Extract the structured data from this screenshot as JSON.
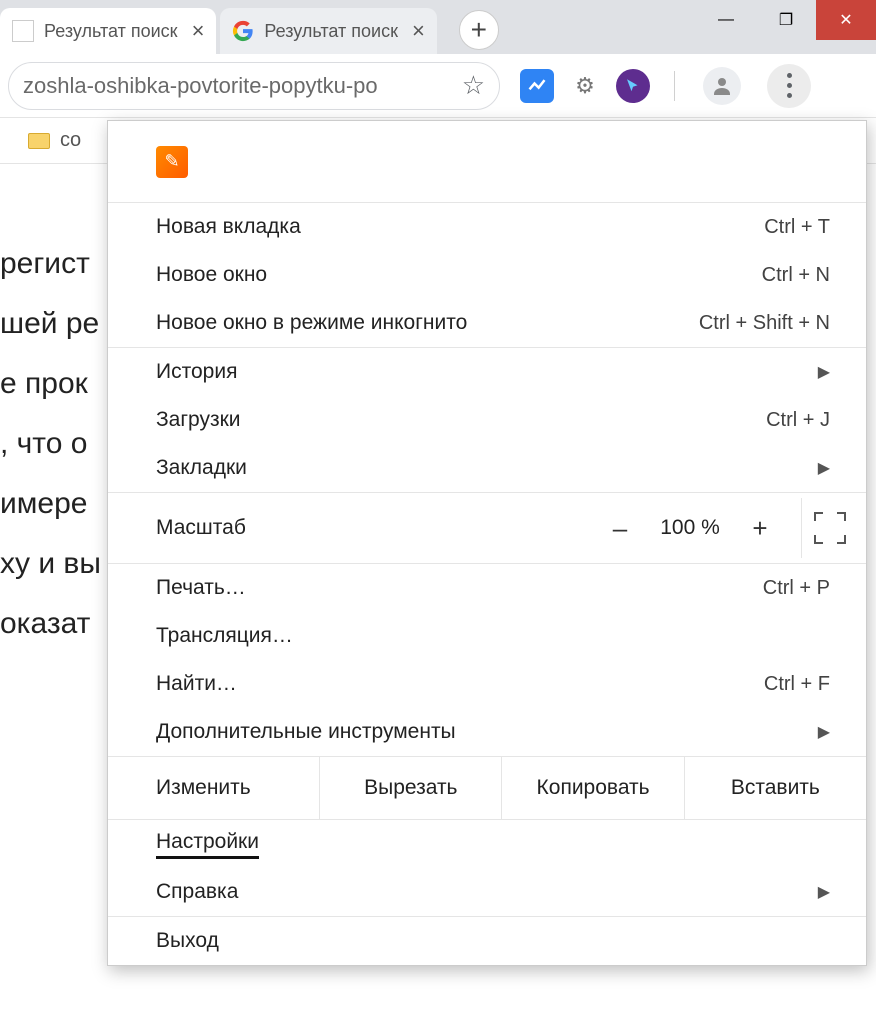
{
  "tabs": [
    {
      "title": "Результат поиск",
      "active": true,
      "favicon": "blank"
    },
    {
      "title": "Результат поиск",
      "active": false,
      "favicon": "google"
    }
  ],
  "newtab_tooltip": "+",
  "window_controls": {
    "min": "—",
    "max": "❐",
    "close": "✕"
  },
  "omnibox": {
    "url": "zoshla-oshibka-povtorite-popytku-po",
    "star_state": "unstarred"
  },
  "extensions": [
    {
      "name": "line-chart",
      "glyph": "✓"
    },
    {
      "name": "settings-gear",
      "glyph": "⚙"
    },
    {
      "name": "cursor-click",
      "glyph": "↖"
    }
  ],
  "bookmarks_bar": [
    {
      "label": "co",
      "type": "folder"
    }
  ],
  "page_lines": [
    "регист",
    "шей ре",
    "е прок",
    ", что о",
    "имере",
    "",
    "ху и вы",
    "",
    "",
    "оказат"
  ],
  "menu": {
    "section1": [
      {
        "label": "Новая вкладка",
        "shortcut": "Ctrl + T"
      },
      {
        "label": "Новое окно",
        "shortcut": "Ctrl + N"
      },
      {
        "label": "Новое окно в режиме инкогнито",
        "shortcut": "Ctrl + Shift + N"
      }
    ],
    "section2": [
      {
        "label": "История",
        "shortcut": "",
        "submenu": true
      },
      {
        "label": "Загрузки",
        "shortcut": "Ctrl + J"
      },
      {
        "label": "Закладки",
        "shortcut": "",
        "submenu": true
      }
    ],
    "zoom": {
      "label": "Масштаб",
      "value": "100 %",
      "minus": "–",
      "plus": "+"
    },
    "section3": [
      {
        "label": "Печать…",
        "shortcut": "Ctrl + P"
      },
      {
        "label": "Трансляция…",
        "shortcut": ""
      },
      {
        "label": "Найти…",
        "shortcut": "Ctrl + F"
      },
      {
        "label": "Дополнительные инструменты",
        "shortcut": "",
        "submenu": true
      }
    ],
    "edit": {
      "label": "Изменить",
      "cut": "Вырезать",
      "copy": "Копировать",
      "paste": "Вставить"
    },
    "section4": [
      {
        "label": "Настройки",
        "highlighted": true
      },
      {
        "label": "Справка",
        "submenu": true
      }
    ],
    "section5": [
      {
        "label": "Выход"
      }
    ]
  }
}
